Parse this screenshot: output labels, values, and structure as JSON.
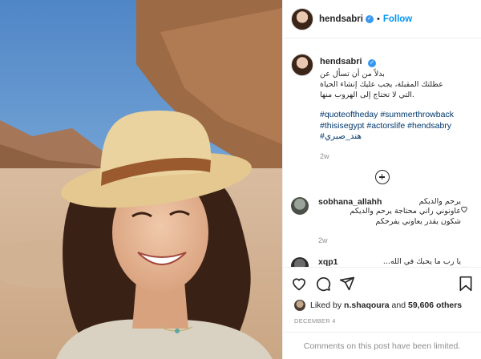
{
  "post": {
    "username": "hendsabri",
    "verified_icon": "verified-badge-icon",
    "separator": "•",
    "follow_label": "Follow"
  },
  "caption": {
    "username": "hendsabri",
    "lines": [
      "بدلاً من أن تسأل عن",
      "عطلتك المقبلة، يجب عليك إنشاء الحياة",
      ".التي لا تحتاج إلى الهروب منها"
    ],
    "hashtags": [
      "#quoteoftheday",
      "#summerthrowback",
      "#thisisegypt",
      "#actorslife",
      "#hendsabry",
      "#هند_صبري"
    ],
    "time": "2w"
  },
  "comments": [
    {
      "username": "sobhana_allahh",
      "lines": [
        "يرحم والديكم",
        "عاونوني راني محتاجة يرحم والديكم",
        "شكون يقدر يعاوني يفرحكم"
      ],
      "time": "2w"
    },
    {
      "username": "xqp1",
      "lines": [
        "...يا رب ما يحبك في الله"
      ],
      "time": ""
    }
  ],
  "likes": {
    "liked_by_prefix": "Liked by",
    "first_liker": "n.shaqoura",
    "and": "and",
    "others": "59,606 others"
  },
  "date": "DECEMBER 4",
  "limited_notice": "Comments on this post have been limited.",
  "colors": {
    "accent": "#0095f6",
    "hashtag": "#00376b",
    "muted": "#8e8e8e",
    "text": "#262626"
  }
}
